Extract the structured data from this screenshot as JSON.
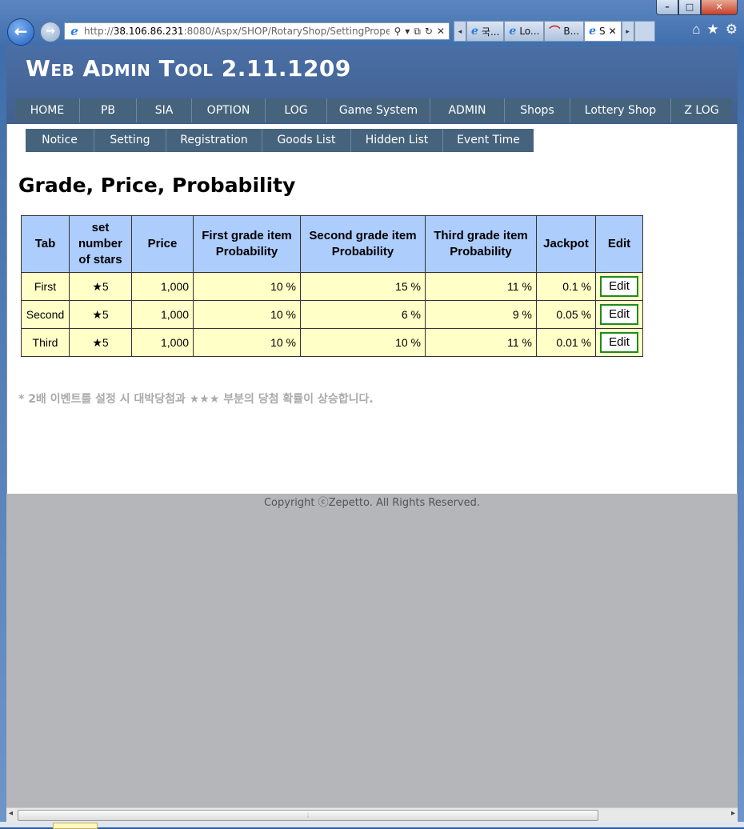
{
  "browser": {
    "url_prefix": "http://",
    "url_host": "38.106.86.231",
    "url_rest": ":8080/Aspx/SHOP/RotaryShop/SettingProperty.",
    "tabs": [
      {
        "label": "국..."
      },
      {
        "label": "Lo..."
      },
      {
        "label": "B..."
      },
      {
        "label": "S"
      }
    ]
  },
  "header": {
    "logo": "Web Admin Tool 2.11.1209"
  },
  "main_nav": [
    "HOME",
    "PB",
    "SIA",
    "OPTION",
    "LOG",
    "Game System",
    "ADMIN",
    "Shops",
    "Lottery Shop",
    "Z LOG"
  ],
  "sub_nav": [
    "Notice",
    "Setting",
    "Registration",
    "Goods List",
    "Hidden List",
    "Event Time"
  ],
  "page_title": "Grade, Price, Probability",
  "table": {
    "headers": [
      "Tab",
      "set number of stars",
      "Price",
      "First grade item Probability",
      "Second grade item Probability",
      "Third grade item Probability",
      "Jackpot",
      "Edit"
    ],
    "rows": [
      {
        "tab": "First",
        "stars": "★5",
        "price": "1,000",
        "first": "10 %",
        "second": "15 %",
        "third": "11 %",
        "jackpot": "0.1 %",
        "edit": "Edit"
      },
      {
        "tab": "Second",
        "stars": "★5",
        "price": "1,000",
        "first": "10 %",
        "second": "6 %",
        "third": "9 %",
        "jackpot": "0.05 %",
        "edit": "Edit"
      },
      {
        "tab": "Third",
        "stars": "★5",
        "price": "1,000",
        "first": "10 %",
        "second": "10 %",
        "third": "11 %",
        "jackpot": "0.01 %",
        "edit": "Edit"
      }
    ]
  },
  "note": "* 2배 이벤트를 설정 시 대박당첨과 ★★★ 부분의 당첨 확률이 상승합니다.",
  "footer": "Copyright ⓒZepetto. All Rights Reserved.",
  "colors": {
    "header_bg": "#4a6fa6",
    "nav_bg": "#46637e",
    "table_header_bg": "#adcdfd",
    "table_cell_bg": "#ffffc8",
    "edit_border": "#1f8a1f"
  }
}
